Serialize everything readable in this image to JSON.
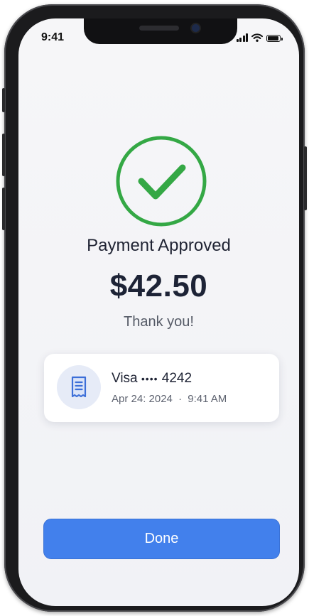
{
  "status_bar": {
    "time": "9:41"
  },
  "result": {
    "title": "Payment Approved",
    "amount": "$42.50",
    "message": "Thank you!",
    "accent_color": "#34a845"
  },
  "receipt_card": {
    "icon": "receipt-icon",
    "card_brand": "Visa",
    "masked_digits": "••••",
    "last_four": "4242",
    "date": "Apr 24: 2024",
    "separator": "·",
    "time": "9:41 AM"
  },
  "actions": {
    "done_label": "Done",
    "done_color": "#4280ec"
  }
}
